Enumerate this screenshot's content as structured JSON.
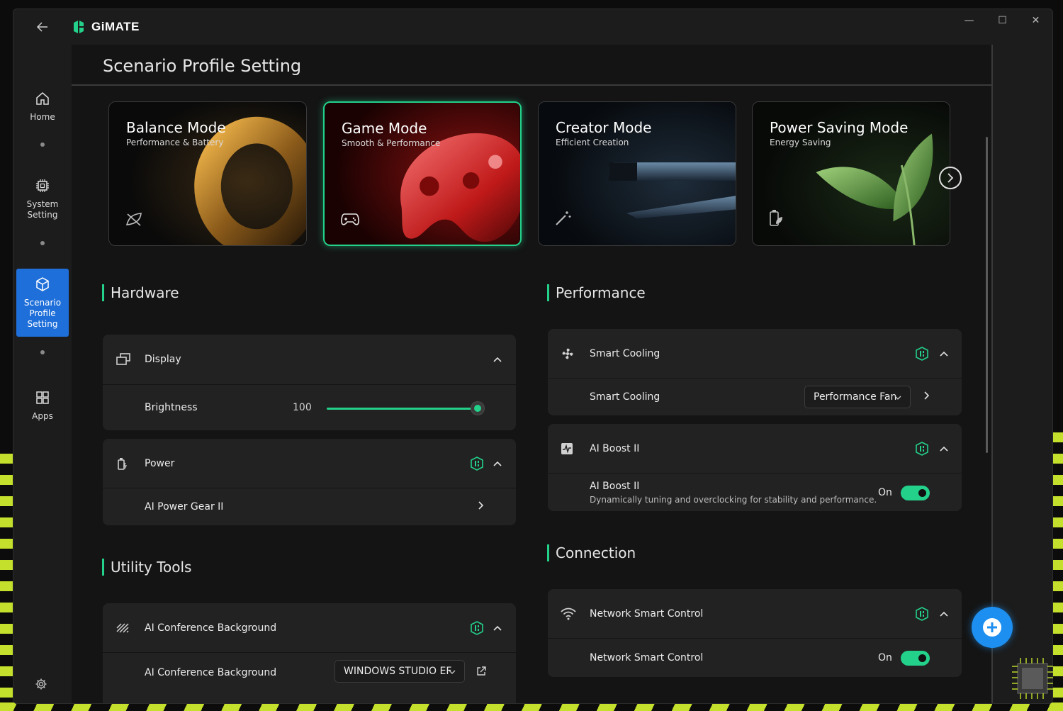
{
  "app": {
    "name": "GiMATE"
  },
  "window_controls": {
    "minimize": "—",
    "maximize": "☐",
    "close": "✕"
  },
  "sidebar": {
    "items": [
      {
        "label": "Home",
        "icon": "home-icon",
        "active": false
      },
      {
        "label": "System\nSetting",
        "icon": "chip-icon",
        "active": false
      },
      {
        "label": "Scenario\nProfile\nSetting",
        "icon": "cube-icon",
        "active": true
      },
      {
        "label": "Apps",
        "icon": "apps-grid-icon",
        "active": false
      }
    ]
  },
  "page": {
    "title": "Scenario Profile Setting"
  },
  "modes": [
    {
      "title": "Balance Mode",
      "subtitle": "Performance & Battery",
      "icon": "balance-icon",
      "active": false
    },
    {
      "title": "Game Mode",
      "subtitle": "Smooth & Performance",
      "icon": "gamepad-icon",
      "active": true
    },
    {
      "title": "Creator Mode",
      "subtitle": "Efficient Creation",
      "icon": "magic-wand-icon",
      "active": false
    },
    {
      "title": "Power Saving Mode",
      "subtitle": "Energy Saving",
      "icon": "battery-leaf-icon",
      "active": false
    }
  ],
  "hardware": {
    "title": "Hardware",
    "display": {
      "label": "Display",
      "brightness_label": "Brightness",
      "brightness_value": "100",
      "brightness_level": 100
    },
    "power": {
      "label": "Power",
      "gear_label": "AI Power Gear II"
    }
  },
  "utility": {
    "title": "Utility Tools",
    "conference": {
      "label": "AI Conference Background",
      "sub_label": "AI Conference Background",
      "dropdown_value": "WINDOWS STUDIO EF"
    }
  },
  "performance": {
    "title": "Performance",
    "smart_cooling": {
      "label": "Smart Cooling",
      "sub_label": "Smart Cooling",
      "dropdown_value": "Performance Fan"
    },
    "ai_boost": {
      "label": "AI Boost II",
      "sub_label": "AI Boost II",
      "description": "Dynamically tuning and overclocking for stability and performance.",
      "state": "On"
    }
  },
  "connection": {
    "title": "Connection",
    "network": {
      "label": "Network Smart Control",
      "sub_label": "Network Smart Control",
      "state": "On"
    }
  },
  "colors": {
    "accent": "#23d18b",
    "active_nav": "#1e6fd9",
    "fab": "#1d8ff0",
    "background": "#141414",
    "panel": "#222222"
  }
}
